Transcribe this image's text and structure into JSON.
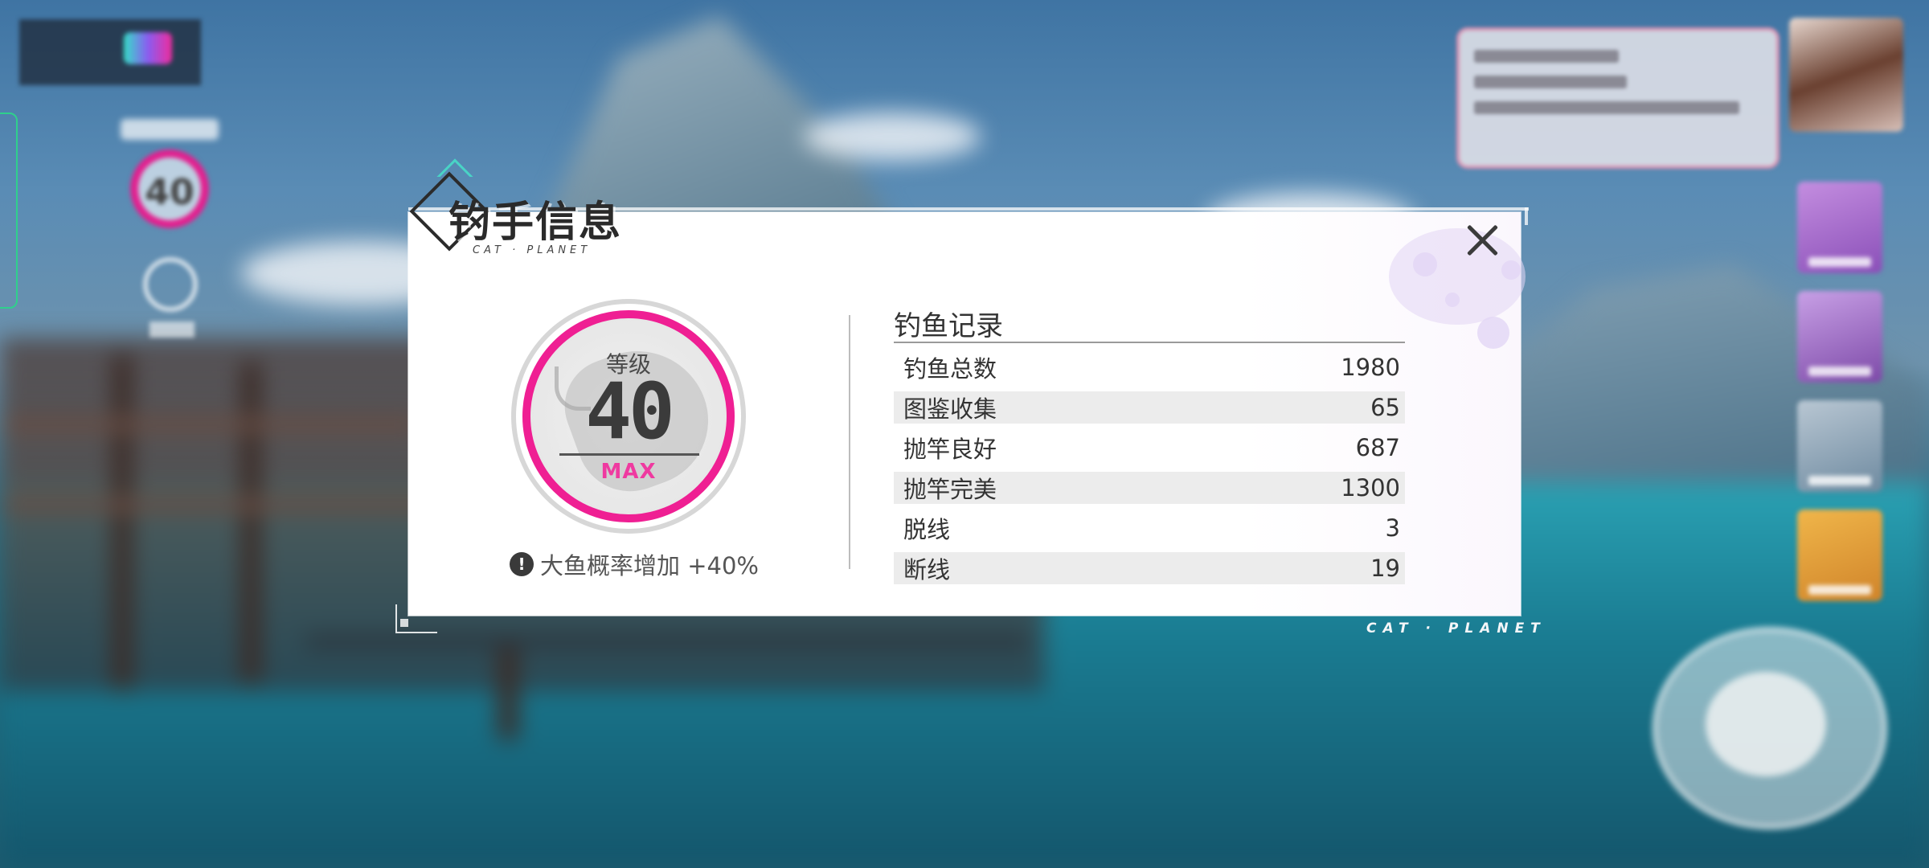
{
  "modal": {
    "title": "钓手信息",
    "subtitle": "CAT · PLANET",
    "level": {
      "label": "等级",
      "value": "40",
      "max_label": "MAX",
      "ring_color": "#ef1f93"
    },
    "bonus": {
      "icon": "exclamation-icon",
      "text": "大鱼概率增加 +40%"
    },
    "records": {
      "title": "钓鱼记录",
      "rows": [
        {
          "label": "钓鱼总数",
          "value": "1980"
        },
        {
          "label": "图鉴收集",
          "value": "65"
        },
        {
          "label": "抛竿良好",
          "value": "687"
        },
        {
          "label": "抛竿完美",
          "value": "1300"
        },
        {
          "label": "脱线",
          "value": "3"
        },
        {
          "label": "断线",
          "value": "19"
        }
      ]
    },
    "close_icon": "close-icon"
  },
  "brand": "CAT · PLANET",
  "hud": {
    "level_value": "40"
  },
  "colors": {
    "accent_pink": "#ef1f93",
    "max_pink": "#ef3aa0",
    "teal": "#49d3c6"
  }
}
